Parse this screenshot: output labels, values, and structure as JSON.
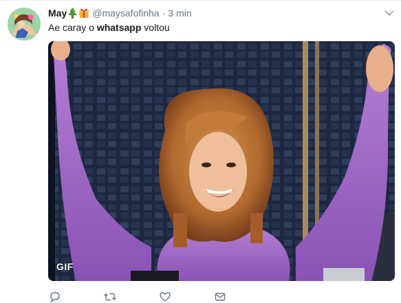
{
  "tweet": {
    "display_name": "May",
    "display_emoji": [
      "christmas-tree",
      "gift"
    ],
    "handle": "@maysafofinha",
    "separator": "·",
    "time": "3 min",
    "text_before": "Ae caray o ",
    "text_bold": "whatsapp",
    "text_after": " voltou",
    "media": {
      "type": "gif",
      "badge": "GIF"
    },
    "actions": [
      "reply-icon",
      "retweet-icon",
      "like-icon",
      "direct-message-icon"
    ]
  },
  "colors": {
    "secondary_text": "#657786",
    "primary_text": "#14171a",
    "border": "#e6ecf0"
  }
}
